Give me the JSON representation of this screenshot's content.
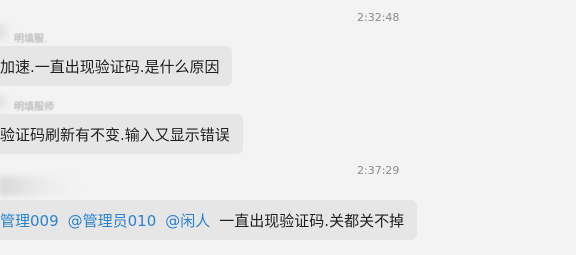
{
  "messages": [
    {
      "timestamp": "2:32:48",
      "sender": "明填服.",
      "text": "加速.一直出现验证码.是什么原因"
    },
    {
      "sender": "明填服师",
      "text": "验证码刷新有不变.输入又显示错误"
    },
    {
      "timestamp": "2:37:29",
      "mentions": [
        "管理009",
        "@管理员010",
        "@闲人"
      ],
      "text": "一直出现验证码.关都关不掉"
    }
  ]
}
